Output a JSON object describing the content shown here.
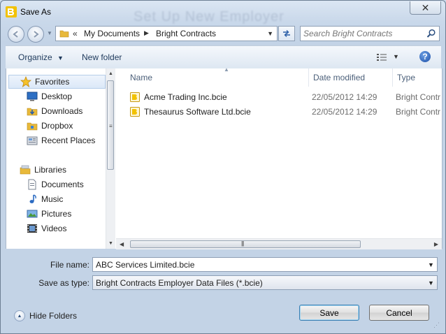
{
  "window": {
    "title": "Save As",
    "background_title": "Set Up New Employer",
    "close_symbol": "✕"
  },
  "address_bar": {
    "overflow_chevron": "«",
    "crumbs": [
      "My Documents",
      "Bright Contracts"
    ]
  },
  "search": {
    "placeholder": "Search Bright Contracts"
  },
  "toolbar": {
    "organize_label": "Organize",
    "new_folder_label": "New folder",
    "help_symbol": "?"
  },
  "nav_tree": {
    "favorites": {
      "label": "Favorites",
      "items": [
        "Desktop",
        "Downloads",
        "Dropbox",
        "Recent Places"
      ]
    },
    "libraries": {
      "label": "Libraries",
      "items": [
        "Documents",
        "Music",
        "Pictures",
        "Videos"
      ]
    }
  },
  "columns": {
    "name": "Name",
    "date_modified": "Date modified",
    "type": "Type"
  },
  "files": [
    {
      "name": "Acme Trading Inc.bcie",
      "date": "22/05/2012 14:29",
      "type": "Bright Contr"
    },
    {
      "name": "Thesaurus Software Ltd.bcie",
      "date": "22/05/2012 14:29",
      "type": "Bright Contr"
    }
  ],
  "form": {
    "file_name_label": "File name:",
    "file_name_value": "ABC Services Limited.bcie",
    "save_type_label": "Save as type:",
    "save_type_value": "Bright Contracts Employer Data Files (*.bcie)"
  },
  "footer": {
    "hide_folders_label": "Hide Folders",
    "save_label": "Save",
    "cancel_label": "Cancel"
  },
  "colors": {
    "accent": "#1e395b",
    "selection": "#dbe8f8",
    "folder": "#e8b93a"
  }
}
